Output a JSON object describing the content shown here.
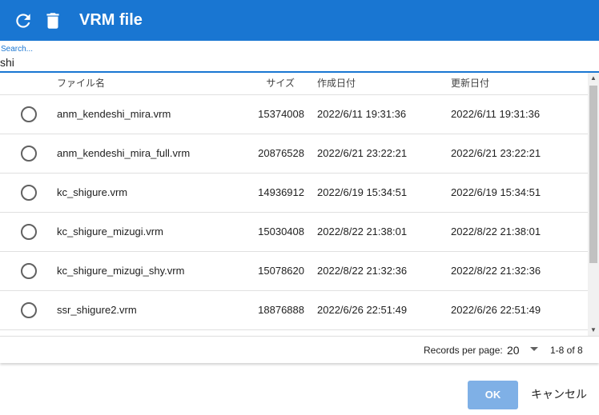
{
  "app": {
    "title": "VRM file",
    "header_color": "#1976d2"
  },
  "toolbar": {
    "refresh_icon": "refresh-icon",
    "delete_icon": "trash-icon"
  },
  "search": {
    "label": "Search...",
    "value": "shi"
  },
  "table": {
    "columns": {
      "name": "ファイル名",
      "size": "サイズ",
      "created": "作成日付",
      "updated": "更新日付"
    },
    "rows": [
      {
        "name": "anm_kendeshi_mira.vrm",
        "size": "15374008",
        "created": "2022/6/11 19:31:36",
        "updated": "2022/6/11 19:31:36"
      },
      {
        "name": "anm_kendeshi_mira_full.vrm",
        "size": "20876528",
        "created": "2022/6/21 23:22:21",
        "updated": "2022/6/21 23:22:21"
      },
      {
        "name": "kc_shigure.vrm",
        "size": "14936912",
        "created": "2022/6/19 15:34:51",
        "updated": "2022/6/19 15:34:51"
      },
      {
        "name": "kc_shigure_mizugi.vrm",
        "size": "15030408",
        "created": "2022/8/22 21:38:01",
        "updated": "2022/8/22 21:38:01"
      },
      {
        "name": "kc_shigure_mizugi_shy.vrm",
        "size": "15078620",
        "created": "2022/8/22 21:32:36",
        "updated": "2022/8/22 21:32:36"
      },
      {
        "name": "ssr_shigure2.vrm",
        "size": "18876888",
        "created": "2022/6/26 22:51:49",
        "updated": "2022/6/26 22:51:49"
      }
    ]
  },
  "pager": {
    "records_label": "Records per page:",
    "records_value": "20",
    "range": "1-8 of 8"
  },
  "actions": {
    "ok": "OK",
    "cancel": "キャンセル",
    "ok_color": "#7fb0e6"
  }
}
